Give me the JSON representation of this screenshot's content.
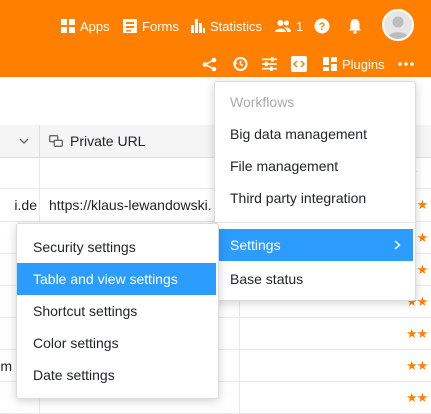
{
  "topbar": {
    "apps_label": "Apps",
    "forms_label": "Forms",
    "statistics_label": "Statistics",
    "collaborators_count": "1",
    "plugins_label": "Plugins"
  },
  "grid": {
    "header_private_url": "Private URL",
    "row1_left": "i.de",
    "row1_url": "https://klaus-lewandowski.",
    "row_m": "m",
    "star_icon": "star-icon"
  },
  "more_menu": {
    "section_label": "Workflows",
    "items": [
      "Big data management",
      "File management",
      "Third party integration"
    ],
    "settings_label": "Settings",
    "base_status_label": "Base status"
  },
  "settings_submenu": {
    "items": [
      "Security settings",
      "Table and view settings",
      "Shortcut settings",
      "Color settings",
      "Date settings"
    ]
  },
  "colors": {
    "brand": "#ff8000",
    "menu_active": "#2d9cff"
  }
}
